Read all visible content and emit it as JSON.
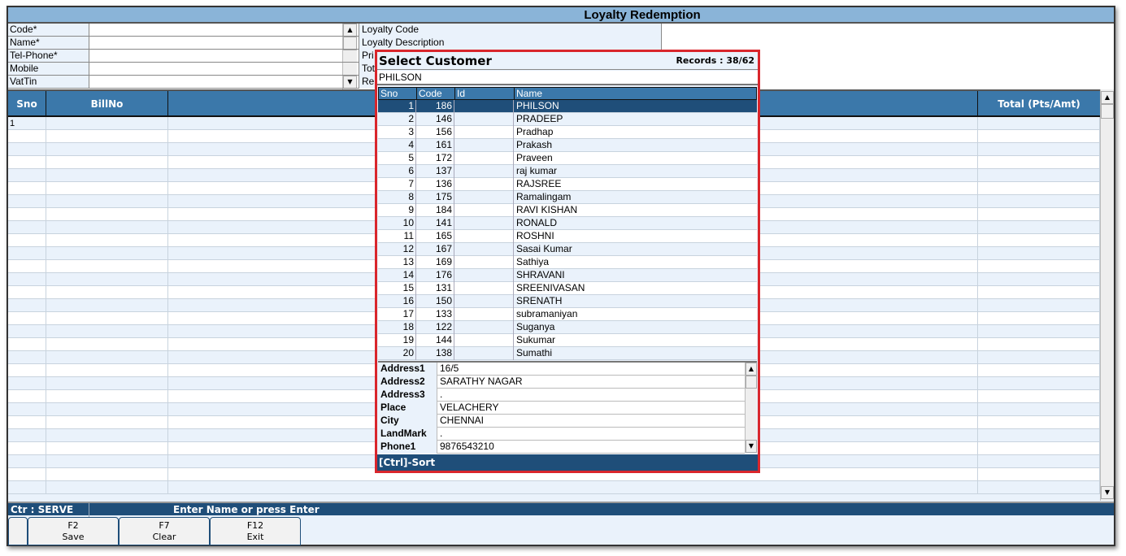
{
  "window": {
    "title": "Loyalty Redemption"
  },
  "form": {
    "left_fields": [
      {
        "label": "Code*",
        "value": ""
      },
      {
        "label": "Name*",
        "value": ""
      },
      {
        "label": "Tel-Phone*",
        "value": ""
      },
      {
        "label": "Mobile",
        "value": ""
      },
      {
        "label": "VatTin",
        "value": ""
      }
    ],
    "right_fields": [
      "Loyalty Code",
      "Loyalty Description",
      "Pri",
      "Tot",
      "Re"
    ]
  },
  "grid": {
    "columns": [
      "Sno",
      "BillNo",
      "",
      "Total (Pts/Amt)"
    ],
    "rows": [
      {
        "sno": "1"
      }
    ]
  },
  "status": {
    "counter": "Ctr : SERVE",
    "middle": "",
    "message": "Enter Name or press Enter"
  },
  "buttons": [
    {
      "key": "F2",
      "label": "Save"
    },
    {
      "key": "F7",
      "label": "Clear"
    },
    {
      "key": "F12",
      "label": "Exit"
    }
  ],
  "popup": {
    "title": "Select Customer",
    "records": "Records : 38/62",
    "search_value": "PHILSON",
    "columns": [
      "Sno",
      "Code",
      "Id",
      "Name"
    ],
    "rows": [
      [
        "1",
        "186",
        "",
        "PHILSON"
      ],
      [
        "2",
        "146",
        "",
        "PRADEEP"
      ],
      [
        "3",
        "156",
        "",
        "Pradhap"
      ],
      [
        "4",
        "161",
        "",
        "Prakash"
      ],
      [
        "5",
        "172",
        "",
        "Praveen"
      ],
      [
        "6",
        "137",
        "",
        "raj kumar"
      ],
      [
        "7",
        "136",
        "",
        "RAJSREE"
      ],
      [
        "8",
        "175",
        "",
        "Ramalingam"
      ],
      [
        "9",
        "184",
        "",
        "RAVI KISHAN"
      ],
      [
        "10",
        "141",
        "",
        "RONALD"
      ],
      [
        "11",
        "165",
        "",
        "ROSHNI"
      ],
      [
        "12",
        "167",
        "",
        "Sasai Kumar"
      ],
      [
        "13",
        "169",
        "",
        "Sathiya"
      ],
      [
        "14",
        "176",
        "",
        "SHRAVANI"
      ],
      [
        "15",
        "131",
        "",
        "SREENIVASAN"
      ],
      [
        "16",
        "150",
        "",
        "SRENATH"
      ],
      [
        "17",
        "133",
        "",
        "subramaniyan"
      ],
      [
        "18",
        "122",
        "",
        "Suganya"
      ],
      [
        "19",
        "144",
        "",
        "Sukumar"
      ],
      [
        "20",
        "138",
        "",
        "Sumathi"
      ]
    ],
    "selected_index": 0,
    "details": [
      {
        "label": "Address1",
        "value": "16/5"
      },
      {
        "label": "Address2",
        "value": "SARATHY NAGAR"
      },
      {
        "label": "Address3",
        "value": "."
      },
      {
        "label": "Place",
        "value": "VELACHERY"
      },
      {
        "label": "City",
        "value": "CHENNAI"
      },
      {
        "label": "LandMark",
        "value": "."
      },
      {
        "label": "Phone1",
        "value": "9876543210"
      }
    ],
    "footer": "[Ctrl]-Sort"
  },
  "colors": {
    "accent_dark": "#1f4e79",
    "header": "#3b78aa",
    "title_bar": "#8ab4d8",
    "popup_border": "#d9262c"
  }
}
